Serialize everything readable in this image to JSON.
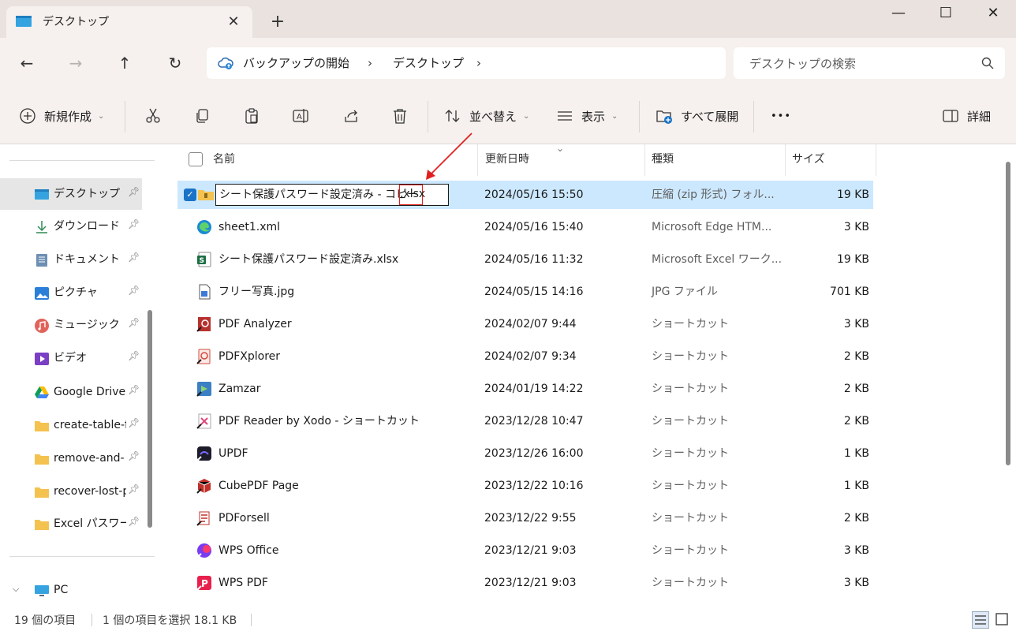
{
  "tab": {
    "title": "デスクトップ",
    "close": "✕",
    "new": "+"
  },
  "window": {
    "minimize": "—",
    "maximize": "☐",
    "close": "✕"
  },
  "nav": {
    "back": "←",
    "forward": "→",
    "up": "↑",
    "refresh": "↻"
  },
  "breadcrumb": {
    "items": [
      "バックアップの開始",
      "デスクトップ"
    ],
    "sep": "›"
  },
  "search": {
    "placeholder": "デスクトップの検索"
  },
  "toolbar": {
    "new_label": "新規作成",
    "sort_label": "並べ替え",
    "view_label": "表示",
    "expand_label": "すべて展開",
    "more_label": "•••",
    "details_label": "詳細"
  },
  "sidebar": {
    "items": [
      {
        "label": "デスクトップ",
        "icon": "desktop-icon"
      },
      {
        "label": "ダウンロード",
        "icon": "download-icon"
      },
      {
        "label": "ドキュメント",
        "icon": "document-icon"
      },
      {
        "label": "ピクチャ",
        "icon": "picture-icon"
      },
      {
        "label": "ミュージック",
        "icon": "music-icon"
      },
      {
        "label": "ビデオ",
        "icon": "video-icon"
      },
      {
        "label": "Google Drive",
        "icon": "google-drive-icon"
      },
      {
        "label": "create-table-f",
        "icon": "folder-icon"
      },
      {
        "label": "remove-and-",
        "icon": "folder-icon"
      },
      {
        "label": "recover-lost-p",
        "icon": "folder-icon"
      },
      {
        "label": "Excel パスワード",
        "icon": "folder-icon"
      }
    ],
    "pc_label": "PC"
  },
  "columns": {
    "name": "名前",
    "date": "更新日時",
    "type": "種類",
    "size": "サイズ"
  },
  "rename": {
    "text": "シート保護パスワード設定済み - コピー",
    "ext": ".xlsx"
  },
  "files": [
    {
      "name": "",
      "date": "2024/05/16 15:50",
      "type": "圧縮 (zip 形式) フォル...",
      "size": "19 KB",
      "icon": "zip-folder-icon"
    },
    {
      "name": "sheet1.xml",
      "date": "2024/05/16 15:40",
      "type": "Microsoft Edge HTM...",
      "size": "3 KB",
      "icon": "edge-icon"
    },
    {
      "name": "シート保護パスワード設定済み.xlsx",
      "date": "2024/05/16 11:32",
      "type": "Microsoft Excel ワーク...",
      "size": "19 KB",
      "icon": "excel-icon"
    },
    {
      "name": "フリー写真.jpg",
      "date": "2024/05/15 14:16",
      "type": "JPG ファイル",
      "size": "701 KB",
      "icon": "image-file-icon"
    },
    {
      "name": "PDF Analyzer",
      "date": "2024/02/07 9:44",
      "type": "ショートカット",
      "size": "3 KB",
      "icon": "pdf-analyzer-icon"
    },
    {
      "name": "PDFXplorer",
      "date": "2024/02/07 9:34",
      "type": "ショートカット",
      "size": "2 KB",
      "icon": "pdfxplorer-icon"
    },
    {
      "name": "Zamzar",
      "date": "2024/01/19 14:22",
      "type": "ショートカット",
      "size": "2 KB",
      "icon": "zamzar-icon"
    },
    {
      "name": "PDF Reader by Xodo - ショートカット",
      "date": "2023/12/28 10:47",
      "type": "ショートカット",
      "size": "2 KB",
      "icon": "xodo-icon"
    },
    {
      "name": "UPDF",
      "date": "2023/12/26 16:00",
      "type": "ショートカット",
      "size": "1 KB",
      "icon": "updf-icon"
    },
    {
      "name": "CubePDF Page",
      "date": "2023/12/22 10:16",
      "type": "ショートカット",
      "size": "1 KB",
      "icon": "cubepdf-icon"
    },
    {
      "name": "PDForsell",
      "date": "2023/12/22 9:55",
      "type": "ショートカット",
      "size": "2 KB",
      "icon": "pdforsell-icon"
    },
    {
      "name": "WPS Office",
      "date": "2023/12/21 9:03",
      "type": "ショートカット",
      "size": "3 KB",
      "icon": "wps-office-icon"
    },
    {
      "name": "WPS PDF",
      "date": "2023/12/21 9:03",
      "type": "ショートカット",
      "size": "3 KB",
      "icon": "wps-pdf-icon"
    }
  ],
  "status": {
    "count": "19 個の項目",
    "selected": "1 個の項目を選択  18.1 KB"
  },
  "colors": {
    "selection": "#cce8ff",
    "accent": "#1a73c7",
    "highlight": "#e02020"
  }
}
